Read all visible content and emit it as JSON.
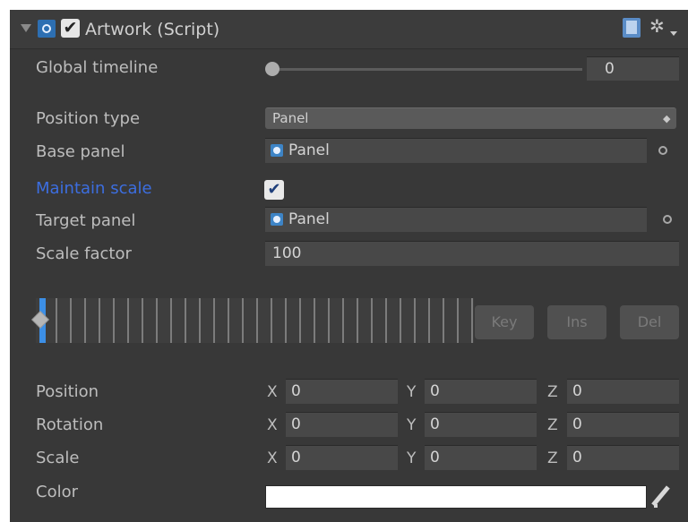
{
  "header": {
    "title": "Artwork (Script)",
    "icons": [
      "collapse-triangle-icon",
      "script-component-icon",
      "enabled-checkbox",
      "help-book-icon",
      "gear-settings-icon"
    ]
  },
  "fields": {
    "global_timeline": {
      "label": "Global timeline",
      "value": "0",
      "slider_level": 0
    },
    "position_type": {
      "label": "Position type",
      "value": "Panel"
    },
    "base_panel": {
      "label": "Base panel",
      "value": "Panel"
    },
    "maintain_scale": {
      "label": "Maintain scale",
      "checked": true,
      "check_glyph": "✔"
    },
    "target_panel": {
      "label": "Target panel",
      "value": "Panel"
    },
    "scale_factor": {
      "label": "Scale factor",
      "value": "100"
    }
  },
  "keyframes": {
    "buttons": {
      "key": "Key",
      "ins": "Ins",
      "del": "Del"
    }
  },
  "transform": {
    "axes": {
      "x": "X",
      "y": "Y",
      "z": "Z"
    },
    "position": {
      "label": "Position",
      "x": "0",
      "y": "0",
      "z": "0"
    },
    "rotation": {
      "label": "Rotation",
      "x": "0",
      "y": "0",
      "z": "0"
    },
    "scale": {
      "label": "Scale",
      "x": "0",
      "y": "0",
      "z": "0"
    }
  },
  "color": {
    "label": "Color",
    "value": "#ffffff"
  },
  "theme": {
    "accent": "#3c8fe6",
    "label_highlight": "#3c6ee0",
    "background": "#383838"
  }
}
